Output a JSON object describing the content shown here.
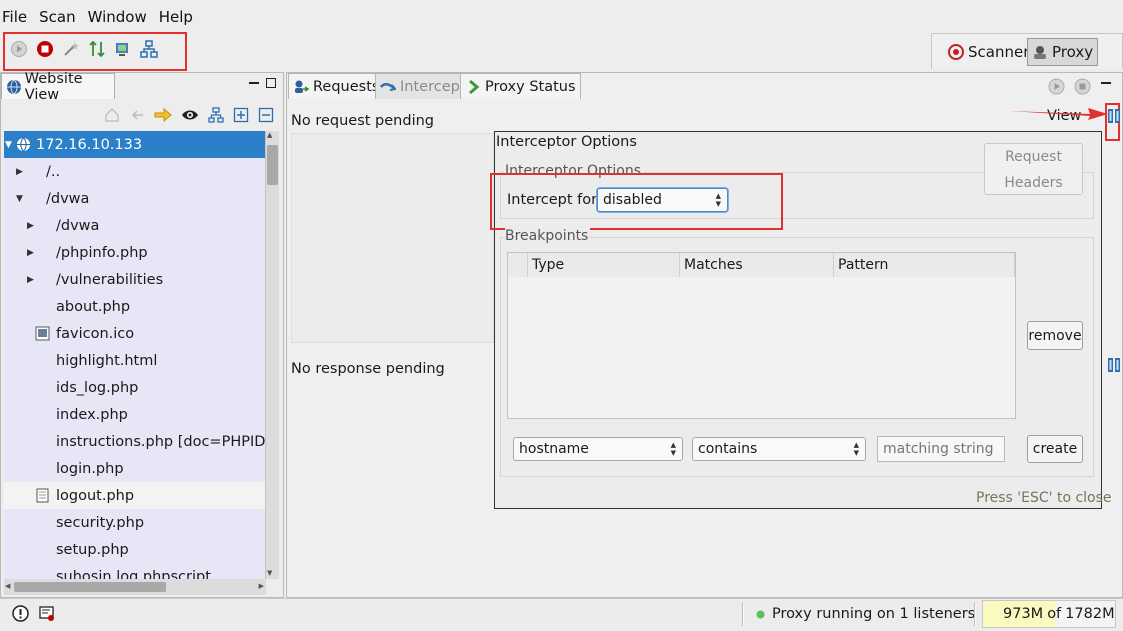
{
  "menu": [
    "File",
    "Scan",
    "Window",
    "Help"
  ],
  "modes": {
    "scanner": "Scanner",
    "proxy": "Proxy"
  },
  "left_panel": {
    "tab_label": "Website View",
    "tree": [
      {
        "label": "172.16.10.133",
        "arrow": "down",
        "selected": true
      },
      {
        "label": "/..",
        "arrow": "right"
      },
      {
        "label": "/dvwa",
        "arrow": "down"
      },
      {
        "label": "/dvwa",
        "arrow": "right"
      },
      {
        "label": "/phpinfo.php",
        "arrow": "right"
      },
      {
        "label": "/vulnerabilities",
        "arrow": "right"
      },
      {
        "label": "about.php"
      },
      {
        "label": "favicon.ico",
        "icon": "image-file-icon"
      },
      {
        "label": "highlight.html"
      },
      {
        "label": "ids_log.php"
      },
      {
        "label": "index.php"
      },
      {
        "label": "instructions.php [doc=PHPIDS-lic"
      },
      {
        "label": "login.php"
      },
      {
        "label": "logout.php",
        "icon": "document-icon",
        "highlighted": true
      },
      {
        "label": "security.php"
      },
      {
        "label": "setup.php"
      },
      {
        "label": "suhosin.log.phpscript"
      }
    ]
  },
  "right_panel": {
    "tabs": {
      "requests": "Requests",
      "intercept": "Intercept",
      "proxy_status": "Proxy Status"
    },
    "request_pending": "No request pending",
    "response_pending": "No response pending",
    "view_label": "View"
  },
  "dialog": {
    "title": "Interceptor Options",
    "group_title": "Interceptor Options",
    "request_headers_button": "Request\nHeaders",
    "request_label": "Request",
    "headers_label": "Headers",
    "intercept_for_label": "Intercept for:",
    "intercept_for_value": "disabled",
    "breakpoints_title": "Breakpoints",
    "table_headers": {
      "type": "Type",
      "matches": "Matches",
      "pattern": "Pattern"
    },
    "remove_button": "remove",
    "field_select": "hostname",
    "operator_select": "contains",
    "matching_placeholder": "matching string",
    "create_button": "create",
    "esc_hint": "Press 'ESC' to close"
  },
  "status": {
    "proxy_text": "Proxy running on 1 listeners",
    "memory_used": "973M",
    "memory_of": "of",
    "memory_total": "1782M",
    "memory_fraction": 0.546
  },
  "colors": {
    "selection": "#2c80c9",
    "annotation": "#e03030",
    "tree_bg": "#e6e6f7"
  }
}
